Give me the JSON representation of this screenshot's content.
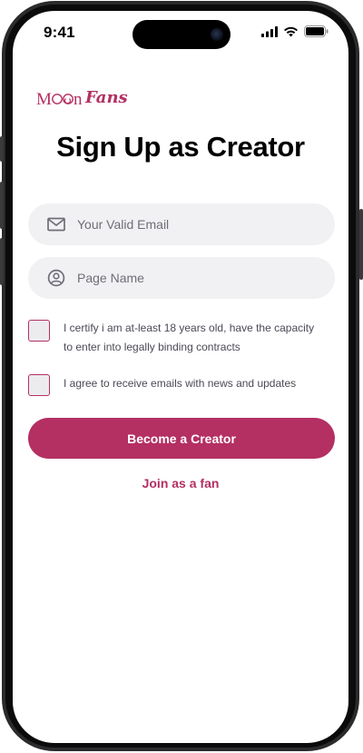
{
  "status_bar": {
    "time": "9:41"
  },
  "brand": {
    "logo_text_part1": "Moon",
    "logo_text_part2": "Fans",
    "accent_color": "#b42f62"
  },
  "page": {
    "title": "Sign Up as Creator"
  },
  "form": {
    "email": {
      "placeholder": "Your Valid Email",
      "value": "",
      "icon": "mail-icon"
    },
    "page_name": {
      "placeholder": "Page Name",
      "value": "",
      "icon": "user-circle-icon"
    },
    "age_checkbox": {
      "label": "I certify i am at-least 18 years old, have the capacity to enter into legally binding contracts",
      "checked": false
    },
    "emails_checkbox": {
      "label": "I agree to receive emails with news and updates",
      "checked": false
    },
    "submit_label": "Become a Creator",
    "fan_link_label": "Join as a fan"
  }
}
